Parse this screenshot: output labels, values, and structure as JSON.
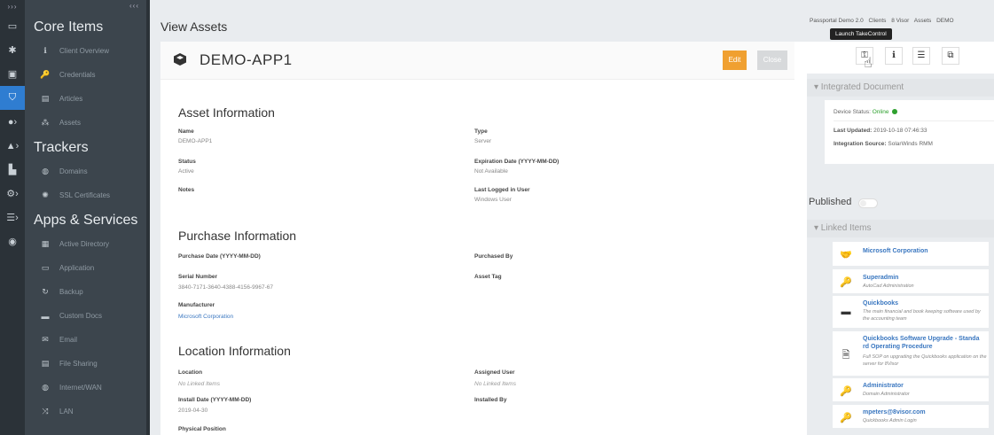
{
  "rail": {
    "top": "›››",
    "icons": [
      "laptop-icon",
      "asterisk-icon",
      "square-icon",
      "shield-icon",
      "user-icon",
      "lock-icon",
      "chart-icon",
      "gears-icon",
      "server-icon",
      "palette-icon"
    ]
  },
  "sidebar": {
    "collapse": "‹‹‹",
    "sections": {
      "core": "Core Items",
      "trackers": "Trackers",
      "apps": "Apps & Services"
    },
    "core_items": [
      {
        "label": "Client Overview",
        "icon": "ℹ"
      },
      {
        "label": "Credentials",
        "icon": "🔑"
      },
      {
        "label": "Articles",
        "icon": "▤"
      },
      {
        "label": "Assets",
        "icon": "⁂"
      }
    ],
    "tracker_items": [
      {
        "label": "Domains",
        "icon": "◍"
      },
      {
        "label": "SSL Certificates",
        "icon": "✺"
      }
    ],
    "app_items": [
      {
        "label": "Active Directory",
        "icon": "▦"
      },
      {
        "label": "Application",
        "icon": "▭"
      },
      {
        "label": "Backup",
        "icon": "↻"
      },
      {
        "label": "Custom Docs",
        "icon": "▬"
      },
      {
        "label": "Email",
        "icon": "✉"
      },
      {
        "label": "File Sharing",
        "icon": "▤"
      },
      {
        "label": "Internet/WAN",
        "icon": "◍"
      },
      {
        "label": "LAN",
        "icon": "⤨"
      }
    ]
  },
  "main": {
    "title": "View Assets",
    "asset_name": "DEMO-APP1",
    "edit_label": "Edit",
    "close_label": "Close",
    "asset_info": {
      "heading": "Asset Information",
      "name_label": "Name",
      "name_value": "DEMO-APP1",
      "type_label": "Type",
      "type_value": "Server",
      "status_label": "Status",
      "status_value": "Active",
      "exp_label": "Expiration Date (YYYY-MM-DD)",
      "exp_value": "Not Available",
      "notes_label": "Notes",
      "lastuser_label": "Last Logged in User",
      "lastuser_value": "Windows User"
    },
    "purchase_info": {
      "heading": "Purchase Information",
      "pdate_label": "Purchase Date (YYYY-MM-DD)",
      "pby_label": "Purchased By",
      "serial_label": "Serial Number",
      "serial_value": "3840-7171-3640-4388-4156-9967-67",
      "tag_label": "Asset Tag",
      "mfr_label": "Manufacturer",
      "mfr_value": "Microsoft Corporation"
    },
    "location_info": {
      "heading": "Location Information",
      "loc_label": "Location",
      "loc_value": "No Linked Items",
      "auser_label": "Assigned User",
      "auser_value": "No Linked Items",
      "idate_label": "Install Date (YYYY-MM-DD)",
      "idate_value": "2019-04-30",
      "iby_label": "Installed By",
      "phys_label": "Physical Position"
    }
  },
  "right": {
    "breadcrumbs": [
      "Passportal Demo 2.0",
      "Clients",
      "8 Visor",
      "Assets",
      "DEMO"
    ],
    "tooltip": "Launch TakeControl",
    "integrated_header": "▾ Integrated Document",
    "device_status_label": "Device Status:",
    "device_status_value": "Online",
    "last_updated_label": "Last Updated:",
    "last_updated_value": "2019-10-18 07:46:33",
    "source_label": "Integration Source:",
    "source_value": "SolarWinds RMM",
    "published_label": "Published",
    "linked_header": "▾ Linked Items",
    "linked": [
      {
        "icon": "handshake-icon",
        "glyph": "🤝",
        "title": "Microsoft Corporation",
        "desc": ""
      },
      {
        "icon": "key-icon",
        "glyph": "🔑",
        "title": "Superadmin",
        "desc": "AutoCad Administration"
      },
      {
        "icon": "window-icon",
        "glyph": "▬",
        "title": "Quickbooks",
        "desc": "The main financial and book keeping software used by the accounting team"
      },
      {
        "icon": "document-icon",
        "glyph": "🗎",
        "title": "Quickbooks Software Upgrade - Standa rd Operating Procedure",
        "desc": "Full SOP on upgrading the Quickbooks application on the server for 8Visor"
      },
      {
        "icon": "key-icon",
        "glyph": "🔑",
        "title": "Administrator",
        "desc": "Domain Administrator"
      },
      {
        "icon": "key-icon",
        "glyph": "🔑",
        "title": "mpeters@8visor.com",
        "desc": "Quickbooks Admin Login"
      }
    ]
  }
}
